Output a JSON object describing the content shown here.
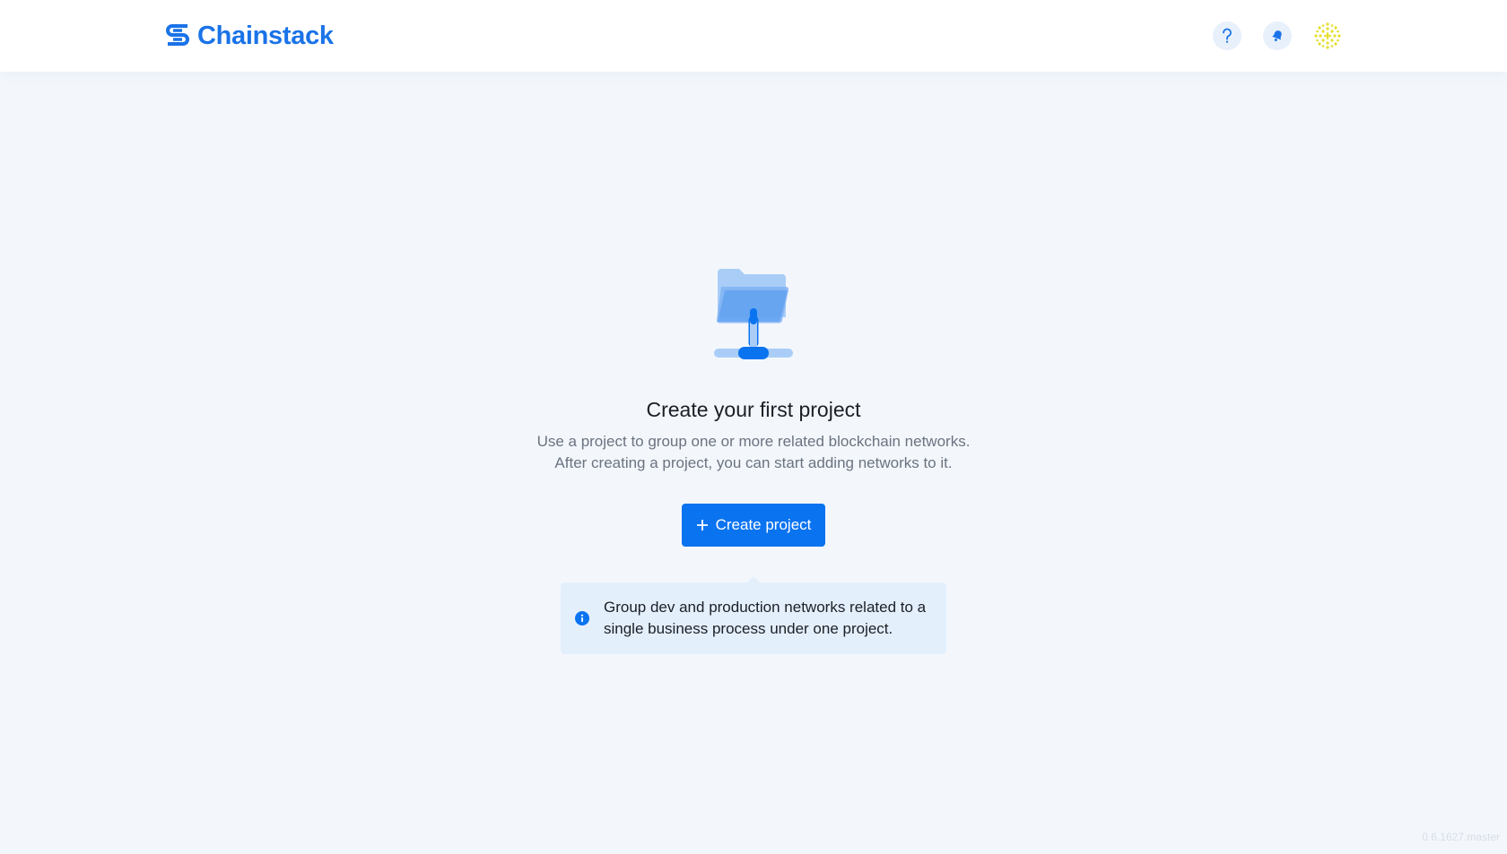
{
  "header": {
    "logo_text": "Chainstack",
    "icons": {
      "logo": "chainstack-logo-icon",
      "help": "question-mark-icon",
      "notifications": "bell-icon",
      "avatar": "user-avatar"
    }
  },
  "empty_state": {
    "illustration": "folder-network-icon",
    "title": "Create your first project",
    "description_lines": [
      "Use a project to group one or more related blockchain networks.",
      "After creating a project, you can start adding networks to it."
    ],
    "create_button_label": "Create project",
    "tip": {
      "icon": "info-icon",
      "text": "Group dev and production networks related to a single business process under one project."
    }
  },
  "footer": {
    "version": "0.6.1627.master"
  },
  "colors": {
    "accent": "#0a73f0",
    "page_background": "#f3f7fc",
    "tip_background": "#e4effc",
    "avatar": "#e6df2a"
  }
}
